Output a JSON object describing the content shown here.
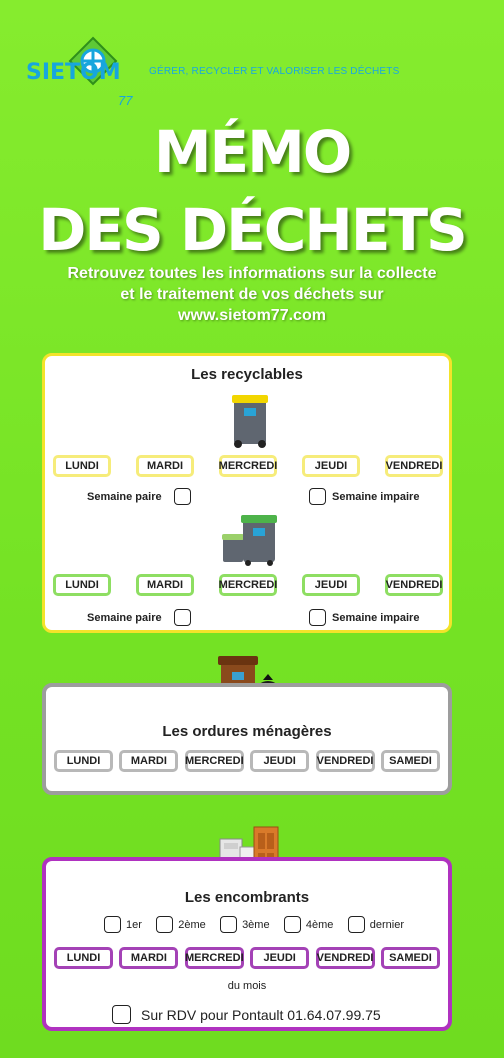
{
  "header": {
    "logo_text": "SIETOM",
    "logo_number": "77",
    "tagline": "GÉRER, RECYCLER ET VALORISER LES DÉCHETS"
  },
  "title": {
    "line1": "MÉMO",
    "line2": "DES DÉCHETS"
  },
  "subtitle": {
    "line1": "Retrouvez toutes les informations sur la collecte",
    "line2": "et le traitement de vos déchets sur",
    "line3": "www.sietom77.com"
  },
  "recyclables": {
    "title": "Les recyclables",
    "border_color": "#f3e32a",
    "yellow_row": [
      "LUNDI",
      "MARDI",
      "MERCREDI",
      "JEUDI",
      "VENDREDI"
    ],
    "green_row": [
      "LUNDI",
      "MARDI",
      "MERCREDI",
      "JEUDI",
      "VENDREDI"
    ],
    "even_week": "Semaine paire",
    "odd_week": "Semaine impaire"
  },
  "ordures": {
    "title": "Les ordures ménagères",
    "border_color": "#9d9d9d",
    "days": [
      "LUNDI",
      "MARDI",
      "MERCREDI",
      "JEUDI",
      "VENDREDI",
      "SAMEDI"
    ]
  },
  "encombrants": {
    "title": "Les encombrants",
    "border_color": "#b032c0",
    "ordinals": [
      "1er",
      "2ème",
      "3ème",
      "4ème",
      "dernier"
    ],
    "days": [
      "LUNDI",
      "MARDI",
      "MERCREDI",
      "JEUDI",
      "VENDREDI",
      "SAMEDI"
    ],
    "month_note": "du mois",
    "rdv": "Sur RDV pour Pontault 01.64.07.99.75"
  },
  "icons": [
    "sietom-logo-icon",
    "yellow-lid-bin-icon",
    "green-bins-icon",
    "brown-bin-icon",
    "garbage-bag-icon",
    "bulky-furniture-icon",
    "checkbox-icon"
  ]
}
